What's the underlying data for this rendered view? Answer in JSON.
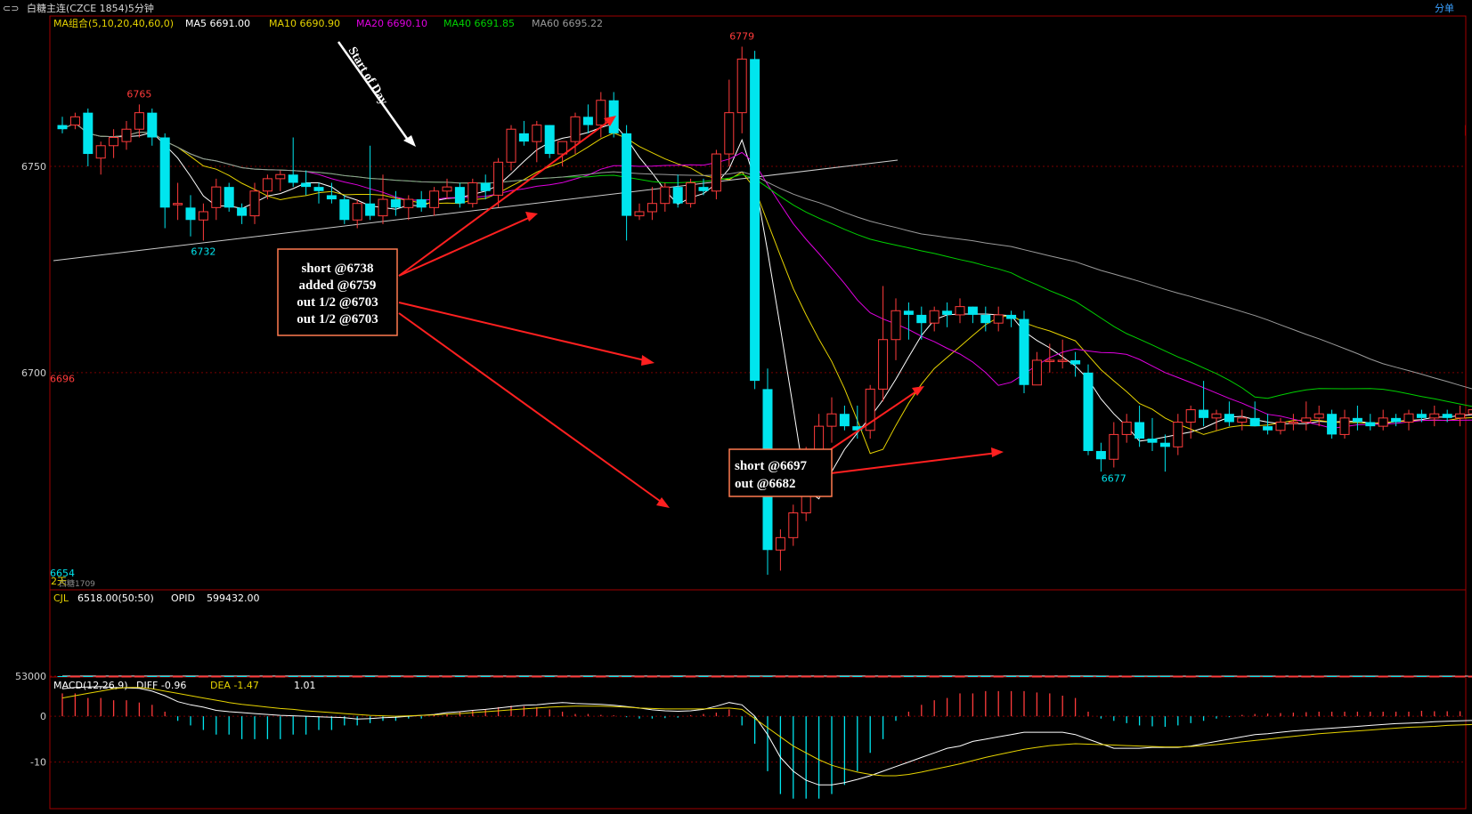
{
  "window": {
    "title": "白糖主连(CZCE 1854)5分钟",
    "corner_label": "分单"
  },
  "colors": {
    "up": "#ff3b3b",
    "down": "#00e5ee",
    "ma5": "#ffffff",
    "ma10": "#e6d300",
    "ma20": "#e000e0",
    "ma40": "#00d000",
    "ma60": "#9a9a9a",
    "annotation_arrow": "#ff2020",
    "grid": "#7a0000"
  },
  "ma_legend": {
    "group": "MA组合(5,10,20,40,60,0)",
    "ma5": "MA5 6691.00",
    "ma10": "MA10 6690.90",
    "ma20": "MA20 6690.10",
    "ma40": "MA40 6691.85",
    "ma60": "MA60 6695.22"
  },
  "volume_legend": {
    "name": "CJL",
    "value": "6518.00(50:50)",
    "opid_label": "OPID",
    "opid_value": "599432.00"
  },
  "macd_legend": {
    "name": "MACD(12,26,9)",
    "diff": "DIFF  -0.96",
    "dea": "DEA  -1.47",
    "macd": "1.01"
  },
  "misc_labels": {
    "contract_switch": "2天",
    "contract_name": "白糖1709"
  },
  "annotations": {
    "start_of_day": "Start of Day",
    "box1_lines": [
      "short   @6738",
      "added @6759",
      "out 1/2 @6703",
      "out 1/2 @6703"
    ],
    "box2_lines": [
      "short @6697",
      "out    @6682"
    ]
  },
  "chart_data": [
    {
      "type": "candlestick",
      "title": "白糖主连(CZCE 1854)5分钟",
      "y_ticks": [
        6750,
        6700
      ],
      "ylim": [
        6648,
        6786
      ],
      "price_labels": [
        {
          "text": "6765",
          "kind": "high"
        },
        {
          "text": "6732",
          "kind": "low"
        },
        {
          "text": "6779",
          "kind": "high"
        },
        {
          "text": "6654",
          "kind": "low"
        },
        {
          "text": "6677",
          "kind": "low"
        },
        {
          "text": "6696",
          "kind": "high"
        }
      ],
      "ohlc": [
        [
          6760,
          6762,
          6758,
          6759
        ],
        [
          6760,
          6763,
          6759,
          6762
        ],
        [
          6763,
          6764,
          6750,
          6753
        ],
        [
          6752,
          6756,
          6748,
          6755
        ],
        [
          6755,
          6759,
          6752,
          6757
        ],
        [
          6756,
          6761,
          6754,
          6759
        ],
        [
          6759,
          6765,
          6757,
          6763
        ],
        [
          6763,
          6764,
          6755,
          6757
        ],
        [
          6757,
          6758,
          6735,
          6740
        ],
        [
          6741,
          6746,
          6737,
          6741
        ],
        [
          6740,
          6743,
          6733,
          6737
        ],
        [
          6737,
          6741,
          6732,
          6739
        ],
        [
          6740,
          6747,
          6737,
          6745
        ],
        [
          6745,
          6746,
          6739,
          6740
        ],
        [
          6740,
          6741,
          6736,
          6738
        ],
        [
          6738,
          6746,
          6736,
          6744
        ],
        [
          6744,
          6748,
          6742,
          6747
        ],
        [
          6747,
          6749,
          6744,
          6748
        ],
        [
          6748,
          6757,
          6745,
          6746
        ],
        [
          6746,
          6749,
          6743,
          6745
        ],
        [
          6745,
          6746,
          6741,
          6744
        ],
        [
          6743,
          6746,
          6741,
          6742
        ],
        [
          6742,
          6743,
          6736,
          6737
        ],
        [
          6737,
          6742,
          6735,
          6741
        ],
        [
          6741,
          6755,
          6737,
          6738
        ],
        [
          6738,
          6748,
          6736,
          6742
        ],
        [
          6742,
          6744,
          6738,
          6740
        ],
        [
          6740,
          6743,
          6737,
          6742
        ],
        [
          6742,
          6744,
          6739,
          6740
        ],
        [
          6740,
          6745,
          6738,
          6744
        ],
        [
          6744,
          6747,
          6742,
          6745
        ],
        [
          6745,
          6746,
          6740,
          6741
        ],
        [
          6741,
          6747,
          6740,
          6746
        ],
        [
          6746,
          6748,
          6742,
          6744
        ],
        [
          6743,
          6752,
          6740,
          6751
        ],
        [
          6751,
          6760,
          6749,
          6759
        ],
        [
          6758,
          6761,
          6755,
          6756
        ],
        [
          6756,
          6761,
          6751,
          6760
        ],
        [
          6760,
          6760,
          6752,
          6753
        ],
        [
          6753,
          6756,
          6750,
          6756
        ],
        [
          6756,
          6763,
          6753,
          6762
        ],
        [
          6762,
          6765,
          6758,
          6760
        ],
        [
          6760,
          6768,
          6757,
          6766
        ],
        [
          6766,
          6768,
          6757,
          6758
        ],
        [
          6758,
          6760,
          6732,
          6738
        ],
        [
          6738,
          6741,
          6737,
          6739
        ],
        [
          6739,
          6745,
          6737,
          6741
        ],
        [
          6741,
          6746,
          6739,
          6745
        ],
        [
          6745,
          6748,
          6740,
          6741
        ],
        [
          6741,
          6747,
          6740,
          6746
        ],
        [
          6745,
          6747,
          6743,
          6744
        ],
        [
          6744,
          6754,
          6742,
          6753
        ],
        [
          6753,
          6771,
          6750,
          6763
        ],
        [
          6763,
          6779,
          6758,
          6776
        ],
        [
          6776,
          6778,
          6696,
          6698
        ],
        [
          6696,
          6701,
          6651,
          6657
        ],
        [
          6657,
          6662,
          6652,
          6660
        ],
        [
          6660,
          6668,
          6658,
          6666
        ],
        [
          6666,
          6682,
          6664,
          6677
        ],
        [
          6677,
          6690,
          6675,
          6687
        ],
        [
          6687,
          6694,
          6683,
          6690
        ],
        [
          6690,
          6692,
          6686,
          6687
        ],
        [
          6687,
          6692,
          6684,
          6686
        ],
        [
          6686,
          6697,
          6684,
          6696
        ],
        [
          6696,
          6721,
          6693,
          6708
        ],
        [
          6708,
          6718,
          6703,
          6715
        ],
        [
          6715,
          6717,
          6708,
          6714
        ],
        [
          6714,
          6716,
          6708,
          6712
        ],
        [
          6712,
          6716,
          6710,
          6715
        ],
        [
          6715,
          6717,
          6711,
          6714
        ],
        [
          6714,
          6718,
          6712,
          6716
        ],
        [
          6716,
          6716,
          6712,
          6714
        ],
        [
          6714,
          6716,
          6710,
          6712
        ],
        [
          6712,
          6716,
          6710,
          6714
        ],
        [
          6714,
          6715,
          6711,
          6713
        ],
        [
          6713,
          6715,
          6695,
          6697
        ],
        [
          6697,
          6705,
          6697,
          6703
        ],
        [
          6703,
          6707,
          6700,
          6703
        ],
        [
          6703,
          6708,
          6701,
          6703
        ],
        [
          6703,
          6705,
          6699,
          6702
        ],
        [
          6700,
          6702,
          6680,
          6681
        ],
        [
          6681,
          6683,
          6676,
          6679
        ],
        [
          6679,
          6688,
          6677,
          6685
        ],
        [
          6685,
          6690,
          6683,
          6688
        ],
        [
          6688,
          6692,
          6682,
          6684
        ],
        [
          6684,
          6689,
          6681,
          6683
        ],
        [
          6683,
          6685,
          6676,
          6682
        ],
        [
          6682,
          6690,
          6680,
          6688
        ],
        [
          6688,
          6692,
          6684,
          6691
        ],
        [
          6691,
          6698,
          6687,
          6689
        ],
        [
          6689,
          6691,
          6686,
          6690
        ],
        [
          6690,
          6693,
          6687,
          6688
        ],
        [
          6688,
          6691,
          6686,
          6689
        ],
        [
          6689,
          6693,
          6687,
          6687
        ],
        [
          6687,
          6690,
          6685,
          6686
        ],
        [
          6686,
          6689,
          6685,
          6688
        ],
        [
          6688,
          6690,
          6686,
          6688
        ],
        [
          6688,
          6693,
          6686,
          6689
        ],
        [
          6689,
          6692,
          6687,
          6690
        ],
        [
          6690,
          6691,
          6684,
          6685
        ],
        [
          6685,
          6691,
          6684,
          6689
        ],
        [
          6689,
          6692,
          6686,
          6688
        ],
        [
          6688,
          6690,
          6686,
          6687
        ],
        [
          6687,
          6691,
          6686,
          6689
        ],
        [
          6689,
          6690,
          6687,
          6688
        ],
        [
          6688,
          6691,
          6686,
          6690
        ],
        [
          6690,
          6691,
          6688,
          6689
        ],
        [
          6689,
          6692,
          6687,
          6690
        ],
        [
          6690,
          6691,
          6688,
          6689
        ],
        [
          6689,
          6692,
          6687,
          6690
        ],
        [
          6690,
          6697,
          6688,
          6691
        ],
        [
          6691,
          6693,
          6685,
          6686
        ]
      ]
    },
    {
      "type": "bar",
      "name": "CJL",
      "y_ticks": [
        53000
      ],
      "ylim": [
        0,
        86000
      ],
      "values": [
        7,
        6,
        9,
        6,
        5,
        7,
        9,
        6,
        16,
        8,
        7,
        6,
        7,
        5,
        6,
        7,
        8,
        6,
        5,
        5,
        6,
        5,
        5,
        6,
        10,
        5,
        5,
        6,
        5,
        6,
        5,
        5,
        7,
        6,
        11,
        8,
        5,
        5,
        5,
        6,
        9,
        8,
        7,
        8,
        20,
        6,
        7,
        7,
        6,
        5,
        5,
        6,
        42,
        58,
        75,
        86,
        55,
        34,
        22,
        20,
        12,
        8,
        6,
        5,
        7,
        20,
        11,
        7,
        8,
        6,
        7,
        6,
        5,
        6,
        5,
        7,
        6,
        5,
        6,
        5,
        5,
        6,
        19,
        14,
        9,
        8,
        7,
        7,
        6,
        6,
        5,
        6,
        5,
        5,
        5,
        5,
        5,
        5,
        5,
        6,
        5,
        5,
        5,
        5,
        5,
        5,
        5,
        5,
        5,
        5,
        5,
        5,
        6,
        5
      ],
      "open_interest_line": [
        79,
        77,
        76,
        76,
        75,
        74,
        74,
        73,
        72,
        71,
        70,
        69,
        68,
        67,
        67,
        66,
        66,
        65,
        64,
        64,
        64,
        64,
        64,
        63,
        63,
        63,
        63,
        63,
        63,
        63,
        63,
        63,
        63,
        63,
        64,
        64,
        65,
        66,
        66,
        67,
        69,
        71,
        72,
        73,
        74,
        72,
        71,
        72,
        73,
        73,
        70,
        65,
        62,
        57,
        57,
        59,
        60,
        61,
        60,
        61,
        62,
        63,
        64,
        64,
        64,
        64,
        64,
        64,
        64,
        64,
        64,
        64,
        64,
        64,
        64,
        64,
        64,
        64,
        64,
        60,
        55,
        41,
        33,
        30,
        28,
        27,
        27,
        26,
        26,
        26,
        26,
        26,
        26,
        26,
        26,
        26,
        26,
        26,
        26,
        26,
        26,
        26,
        26,
        26,
        26,
        26,
        26,
        26,
        26,
        26,
        26,
        26,
        26,
        26,
        26,
        26,
        26
      ]
    },
    {
      "type": "bar",
      "name": "MACD",
      "y_ticks": [
        0,
        -10
      ],
      "ylim": [
        -20,
        8
      ],
      "values": [
        5,
        5,
        4,
        4,
        3.5,
        3.5,
        3,
        2.5,
        1,
        -1,
        -2,
        -3,
        -4,
        -4,
        -5,
        -5,
        -5,
        -5,
        -4,
        -4,
        -3,
        -3,
        -2,
        -2,
        -1.5,
        -1,
        -1,
        -0.5,
        -0.5,
        0.3,
        0.5,
        1,
        1.2,
        1.5,
        2,
        2.3,
        2.2,
        2,
        1.5,
        1,
        0.5,
        0.5,
        0.3,
        0.2,
        -0.2,
        -0.5,
        -0.5,
        -0.4,
        -0.3,
        0.2,
        0.5,
        0.8,
        1.5,
        -2,
        -6,
        -12,
        -17,
        -18,
        -18,
        -18,
        -17,
        -15,
        -12,
        -8,
        -5,
        -1,
        1,
        2.5,
        3.5,
        4,
        5,
        5,
        5.5,
        5.5,
        5.5,
        5.5,
        5.2,
        5,
        4.5,
        4,
        1,
        -0.5,
        -1,
        -1.5,
        -2,
        -2.2,
        -2.3,
        -2,
        -1.5,
        -1,
        -0.5,
        -0.2,
        0.3,
        0.5,
        0.6,
        0.7,
        0.8,
        0.9,
        1,
        1,
        1,
        1,
        1,
        1,
        1,
        1,
        1.2,
        1.1,
        1.1,
        1.1,
        1,
        1,
        1,
        1,
        1,
        1,
        1,
        1
      ],
      "diff": [
        6,
        6.3,
        6.4,
        6.5,
        6.3,
        6.2,
        6.1,
        5.5,
        4.5,
        3.2,
        2.5,
        2,
        1.3,
        1,
        0.8,
        0.6,
        0.4,
        0.2,
        0.1,
        0,
        -0.1,
        -0.2,
        -0.3,
        -0.6,
        -0.5,
        -0.3,
        -0.2,
        0,
        0.2,
        0.4,
        0.8,
        1,
        1.3,
        1.5,
        1.8,
        2.1,
        2.4,
        2.5,
        2.8,
        3,
        2.8,
        2.7,
        2.6,
        2.4,
        2.1,
        1.8,
        1.4,
        1.2,
        1.1,
        1.2,
        1.5,
        2.2,
        3,
        2.5,
        0,
        -4,
        -9,
        -12,
        -14,
        -15,
        -15,
        -14.5,
        -13.8,
        -13,
        -12,
        -11,
        -10,
        -9,
        -8,
        -7,
        -6.5,
        -5.5,
        -5,
        -4.5,
        -4,
        -3.5,
        -3.5,
        -3.5,
        -3.5,
        -4,
        -5,
        -6,
        -7,
        -7,
        -7,
        -6.8,
        -6.8,
        -6.8,
        -6.5,
        -6,
        -5.5,
        -5,
        -4.5,
        -4,
        -3.8,
        -3.5,
        -3.2,
        -3,
        -2.8,
        -2.6,
        -2.4,
        -2.2,
        -2,
        -1.8,
        -1.6,
        -1.5,
        -1.4,
        -1.2,
        -1.1,
        -1,
        -0.9,
        -0.8,
        -0.7,
        -0.6,
        -0.5,
        -0.96
      ],
      "dea": [
        4,
        4.5,
        5,
        5.5,
        6,
        6.3,
        6.3,
        6,
        5.5,
        5,
        4.5,
        4,
        3.5,
        3,
        2.6,
        2.3,
        2,
        1.7,
        1.5,
        1.2,
        1,
        0.8,
        0.6,
        0.4,
        0.2,
        0.1,
        0,
        0.1,
        0.2,
        0.3,
        0.5,
        0.6,
        0.8,
        1,
        1.2,
        1.4,
        1.6,
        1.8,
        2,
        2.1,
        2.2,
        2.2,
        2.2,
        2.1,
        2,
        1.8,
        1.7,
        1.6,
        1.6,
        1.6,
        1.6,
        1.7,
        1.8,
        1.5,
        -0.5,
        -2.5,
        -4.5,
        -6.5,
        -8,
        -9.5,
        -10.7,
        -11.5,
        -12.2,
        -12.7,
        -13,
        -13,
        -12.7,
        -12.2,
        -11.6,
        -11,
        -10.4,
        -9.7,
        -9,
        -8.4,
        -7.8,
        -7.2,
        -6.8,
        -6.4,
        -6.2,
        -6,
        -6.1,
        -6.2,
        -6.3,
        -6.4,
        -6.5,
        -6.6,
        -6.7,
        -6.7,
        -6.6,
        -6.4,
        -6.2,
        -5.9,
        -5.6,
        -5.3,
        -5,
        -4.7,
        -4.4,
        -4.1,
        -3.8,
        -3.6,
        -3.4,
        -3.2,
        -3,
        -2.8,
        -2.6,
        -2.4,
        -2.3,
        -2.2,
        -2,
        -1.9,
        -1.8,
        -1.7,
        -1.6,
        -1.55,
        -1.5,
        -1.47
      ]
    }
  ]
}
